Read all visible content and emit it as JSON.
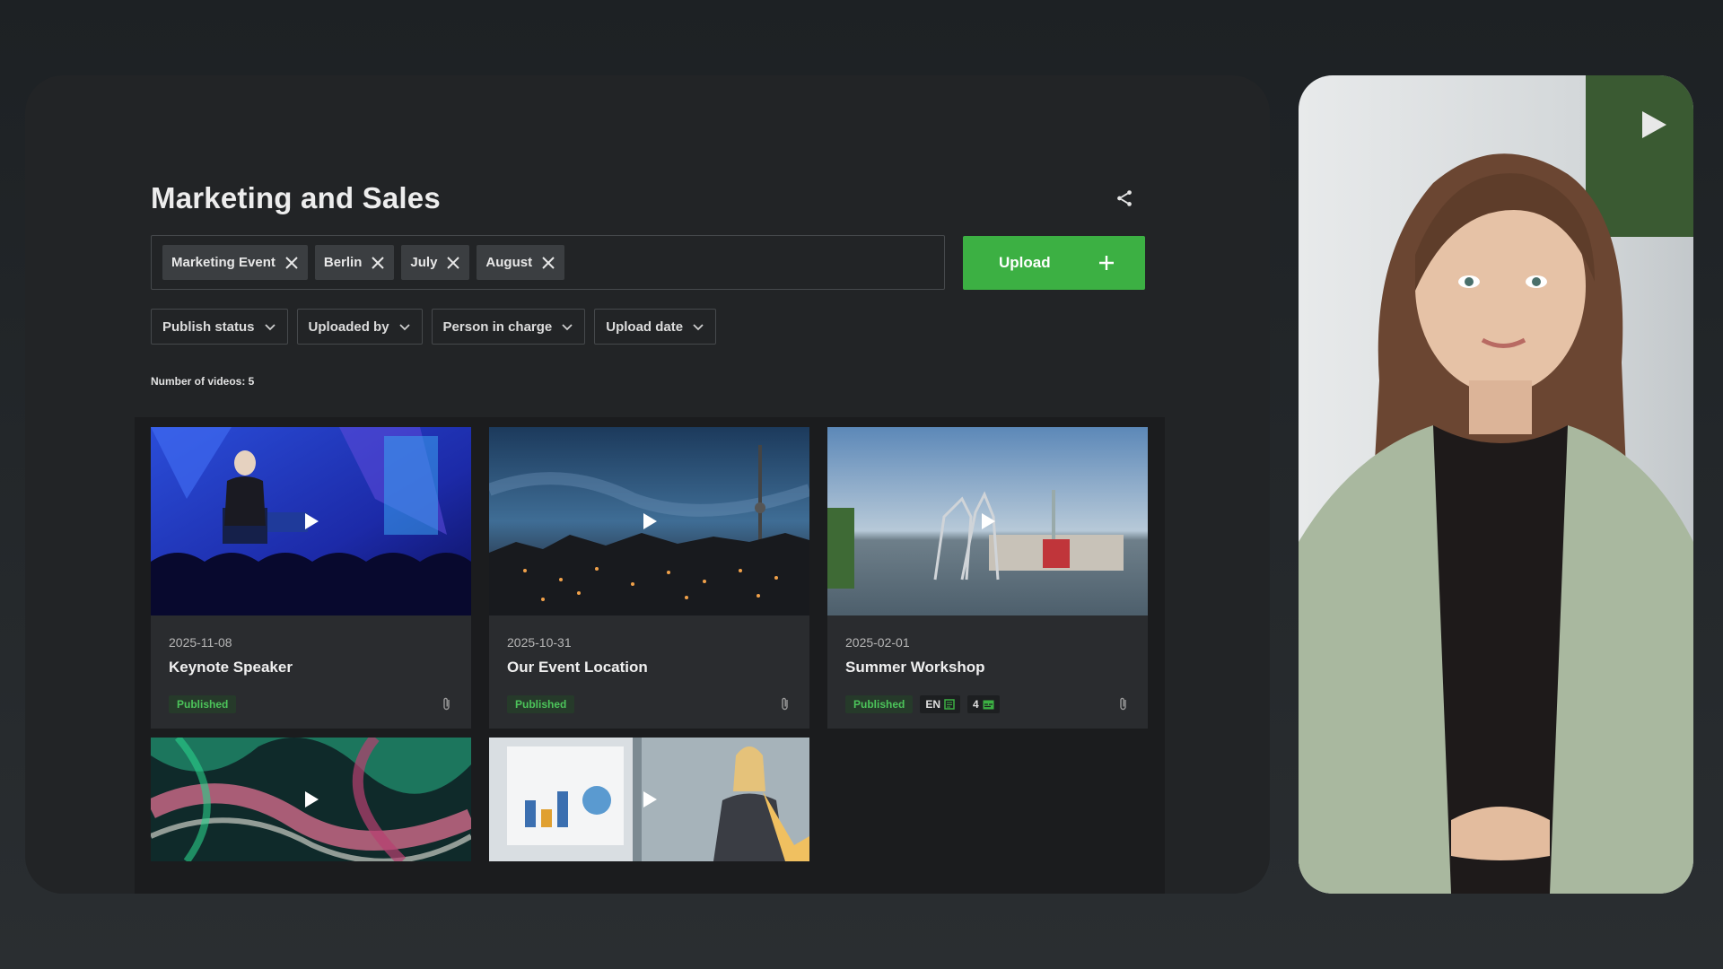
{
  "page": {
    "title": "Marketing and Sales"
  },
  "tags": [
    "Marketing Event",
    "Berlin",
    "July",
    "August"
  ],
  "upload": {
    "label": "Upload"
  },
  "filters": [
    "Publish status",
    "Uploaded by",
    "Person in charge",
    "Upload date"
  ],
  "video_count": "Number of videos: 5",
  "videos": [
    {
      "date": "2025-11-08",
      "title": "Keynote Speaker",
      "status": "Published"
    },
    {
      "date": "2025-10-31",
      "title": "Our Event Location",
      "status": "Published"
    },
    {
      "date": "2025-02-01",
      "title": "Summer Workshop",
      "status": "Published",
      "language": "EN",
      "subtitle_count": "4"
    }
  ],
  "colors": {
    "accent": "#3cb043",
    "panel": "#222426",
    "background": "#24282b"
  },
  "icons": {
    "share": "share-icon",
    "remove": "close-icon",
    "add": "plus-icon",
    "dropdown": "chevron-down-icon",
    "play": "play-icon",
    "attachment": "paperclip-icon"
  }
}
